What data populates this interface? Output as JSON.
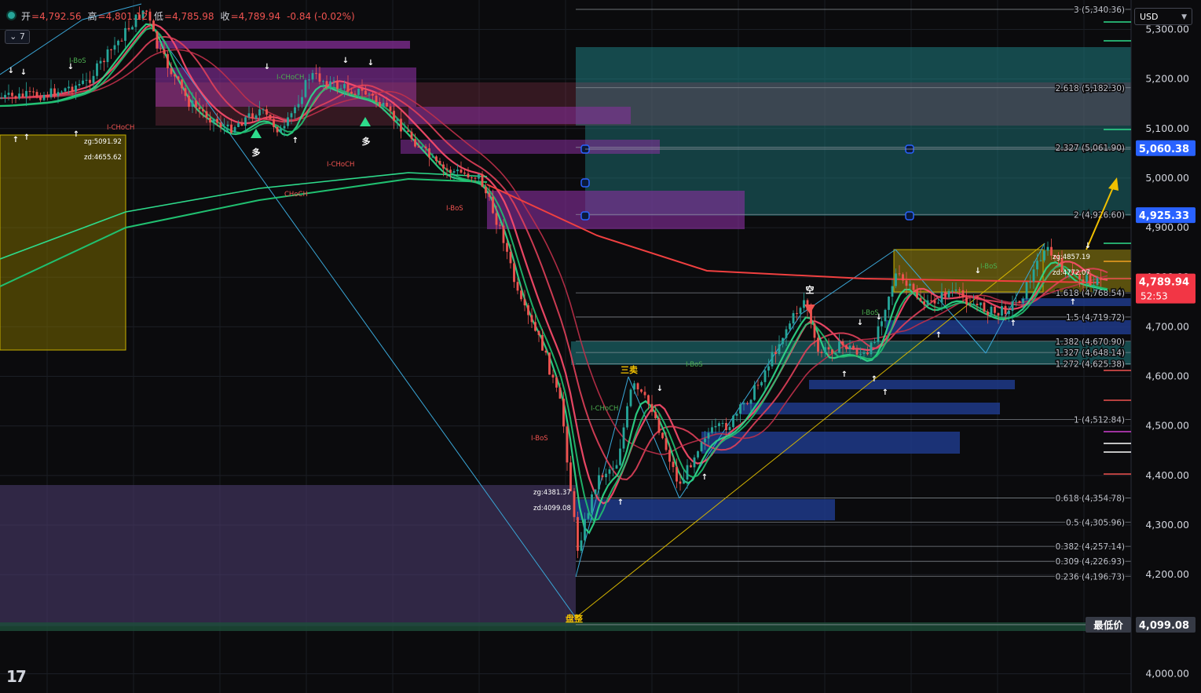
{
  "header": {
    "open_label": "开",
    "open": "=4,792.56",
    "high_label": "高",
    "high": "=4,801.12",
    "low_label": "低",
    "low": "=4,785.98",
    "close_label": "收",
    "close": "=4,789.94",
    "change": "-0.84 (-0.02%)",
    "interval": "7",
    "currency": "USD"
  },
  "colors": {
    "background": "#0b0b0d",
    "up": "#26a69a",
    "down": "#ef5350",
    "fib_line": "#9aa0a8",
    "teal_zone": "#1f7e82",
    "purple_zone": "#8b2fa0",
    "blue_zone": "#1e3a8a",
    "yellow_zone": "#9c8a10",
    "lavender_zone": "#4a3a6a"
  },
  "chart_data": {
    "type": "candlestick",
    "symbol_currency": "USD",
    "y_axis": {
      "range": [
        3960,
        5375
      ],
      "ticks": [
        "5,300.00",
        "5,200.00",
        "5,100.00",
        "5,000.00",
        "4,900.00",
        "4,800.00",
        "4,700.00",
        "4,600.00",
        "4,500.00",
        "4,400.00",
        "4,300.00",
        "4,200.00",
        "4,100.00",
        "4,000.00"
      ],
      "tick_values": [
        5300,
        5200,
        5100,
        5000,
        4900,
        4800,
        4700,
        4600,
        4500,
        4400,
        4300,
        4200,
        4100,
        4000
      ]
    },
    "price_badges": [
      {
        "label": "5,060.38",
        "value": 5060.38,
        "color": "#2962ff"
      },
      {
        "label": "4,925.33",
        "value": 4925.33,
        "color": "#2962ff"
      },
      {
        "label": "4,789.94",
        "value": 4789.94,
        "color": "#f23645",
        "sub": "52:53"
      },
      {
        "label": "4,099.08",
        "value": 4099.08,
        "color": "#363a45",
        "prefix": "最低价"
      }
    ],
    "fib_levels": [
      {
        "label": "3 (5,340.36)",
        "value": 5340.36
      },
      {
        "label": "2.618 (5,182.30)",
        "value": 5182.3
      },
      {
        "label": "2.327 (5,061.90)",
        "value": 5061.9
      },
      {
        "label": "2 (4,926.60)",
        "value": 4926.6
      },
      {
        "label": "1.618 (4,768.54)",
        "value": 4768.54
      },
      {
        "label": "1.5 (4,719.72)",
        "value": 4719.72
      },
      {
        "label": "1.382 (4,670.90)",
        "value": 4670.9
      },
      {
        "label": "1.327 (4,648.14)",
        "value": 4648.14
      },
      {
        "label": "1.272 (4,625.38)",
        "value": 4625.38
      },
      {
        "label": "1 (4,512.84)",
        "value": 4512.84
      },
      {
        "label": "0.618 (4,354.78)",
        "value": 4354.78
      },
      {
        "label": "0.5 (4,305.96)",
        "value": 4305.96
      },
      {
        "label": "0.382 (4,257.14)",
        "value": 4257.14
      },
      {
        "label": "0.309 (4,226.93)",
        "value": 4226.93
      },
      {
        "label": "0.236 (4,196.73)",
        "value": 4196.73
      },
      {
        "label": "0",
        "value": 4099.08
      }
    ],
    "annotations": [
      {
        "text": "I-BoS",
        "color": "#4caf50"
      },
      {
        "text": "I-CHoCH",
        "color": "#4caf50"
      },
      {
        "text": "I-CHoCH",
        "color": "#ef5350"
      },
      {
        "text": "I-CHoCH",
        "color": "#ef5350"
      },
      {
        "text": "CHoCH",
        "color": "#ef5350"
      },
      {
        "text": "I-BoS",
        "color": "#ef5350"
      },
      {
        "text": "I-BoS",
        "color": "#ef5350"
      },
      {
        "text": "I-CHoCH",
        "color": "#4caf50"
      },
      {
        "text": "I-BoS",
        "color": "#4caf50"
      },
      {
        "text": "I-BoS",
        "color": "#4caf50"
      },
      {
        "text": "I-BoS",
        "color": "#4caf50"
      },
      {
        "text": "zg:5091.92",
        "color": "#ffffff"
      },
      {
        "text": "zd:4655.62",
        "color": "#ffffff"
      },
      {
        "text": "zg:4381.37",
        "color": "#ffffff"
      },
      {
        "text": "zd:4099.08",
        "color": "#ffffff"
      },
      {
        "text": "zg:4857.19",
        "color": "#ffffff"
      },
      {
        "text": "zd:4772.07",
        "color": "#ffffff"
      },
      {
        "text": "多",
        "color": "#ffffff"
      },
      {
        "text": "多",
        "color": "#ffffff"
      },
      {
        "text": "空",
        "color": "#ffffff"
      },
      {
        "text": "三卖",
        "color": "#f0c000"
      },
      {
        "text": "盘整",
        "color": "#f0c000"
      }
    ],
    "legend": "none",
    "grid": true
  }
}
